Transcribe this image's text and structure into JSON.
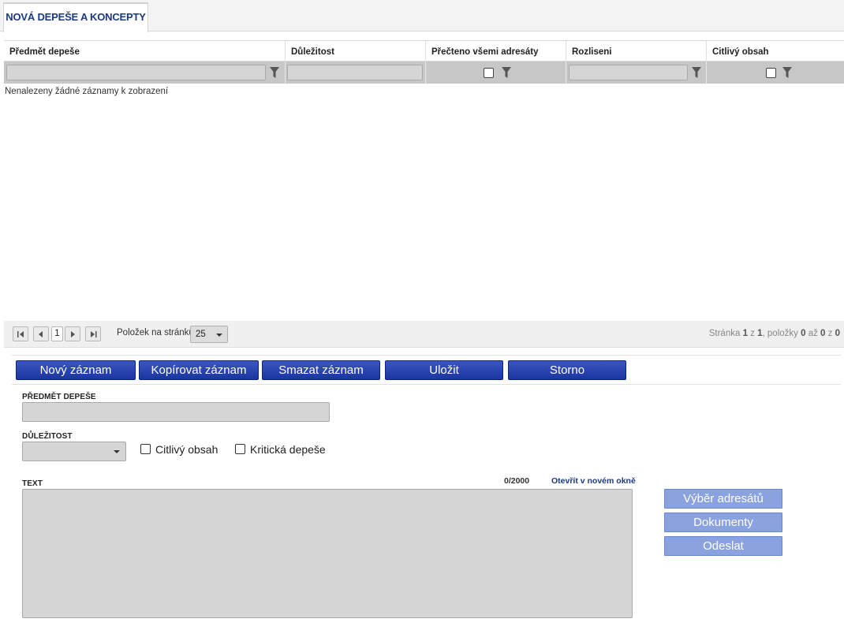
{
  "tab": {
    "label": "NOVÁ DEPEŠE A KONCEPTY"
  },
  "grid": {
    "columns": [
      {
        "label": "Předmět depeše"
      },
      {
        "label": "Důležitost"
      },
      {
        "label": "Přečteno všemi adresáty"
      },
      {
        "label": "Rozliseni"
      },
      {
        "label": "Citlivý obsah"
      }
    ],
    "empty_message": "Nenalezeny žádné záznamy k zobrazení"
  },
  "pager": {
    "current_page": "1",
    "per_page_label": "Položek na stránku",
    "per_page_value": "25",
    "info_prefix": "Stránka ",
    "page": "1",
    "of_word": " z ",
    "total_pages": "1",
    "items_word": ", položky ",
    "from": "0",
    "to_word": " až ",
    "to": "0",
    "of_word2": " z ",
    "total_items": "0"
  },
  "toolbar": {
    "new_label": "Nový záznam",
    "copy_label": "Kopírovat záznam",
    "delete_label": "Smazat záznam",
    "save_label": "Uložit",
    "cancel_label": "Storno"
  },
  "form": {
    "subject_label": "PŘEDMĚT DEPEŠE",
    "importance_label": "DŮLEŽITOST",
    "sensitive_label": "Citlivý obsah",
    "critical_label": "Kritická depeše",
    "text_label": "TEXT",
    "char_counter": "0/2000",
    "open_new_window": "Otevřít v novém okně"
  },
  "side_buttons": {
    "recipients_label": "Výběr adresátů",
    "documents_label": "Dokumenty",
    "send_label": "Odeslat"
  },
  "colors": {
    "primary_button": "#1b35a0",
    "disabled_button": "#8ba2e0",
    "tab_text": "#1c3a80"
  }
}
